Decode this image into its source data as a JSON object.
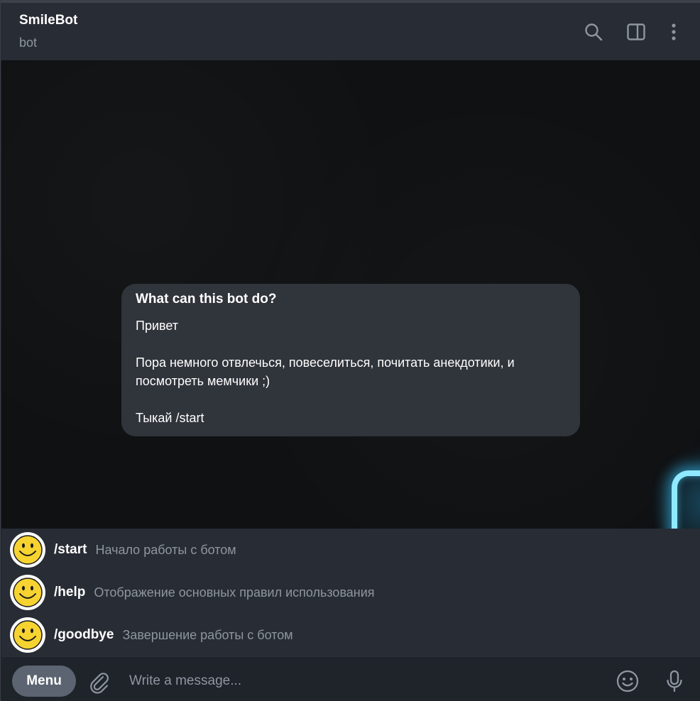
{
  "header": {
    "title": "SmileBot",
    "subtitle": "bot",
    "icons": [
      "search-icon",
      "sidebar-toggle-icon",
      "more-vertical-icon"
    ]
  },
  "bot_info": {
    "title": "What can this bot do?",
    "text": "Привет\n\nПора немного отвлечься, повеселиться, почитать анекдотики, и посмотреть мемчики ;)\n\nТыкай /start"
  },
  "commands": [
    {
      "name": "/start",
      "description": "Начало работы с ботом",
      "icon": "smiley-icon"
    },
    {
      "name": "/help",
      "description": "Отображение основных правил использования",
      "icon": "smiley-icon"
    },
    {
      "name": "/goodbye",
      "description": "Завершение работы с ботом",
      "icon": "smiley-icon"
    }
  ],
  "composer": {
    "menu_label": "Menu",
    "placeholder": "Write a message...",
    "icons": [
      "attach-icon",
      "emoji-icon",
      "microphone-icon"
    ]
  },
  "colors": {
    "header_bg": "#282c34",
    "chat_bg": "#0f1113",
    "bubble_bg": "#30343b",
    "secondary_text": "#8e969f",
    "smiley_yellow": "#f6d330",
    "neon_accent": "#8fe9ff"
  }
}
